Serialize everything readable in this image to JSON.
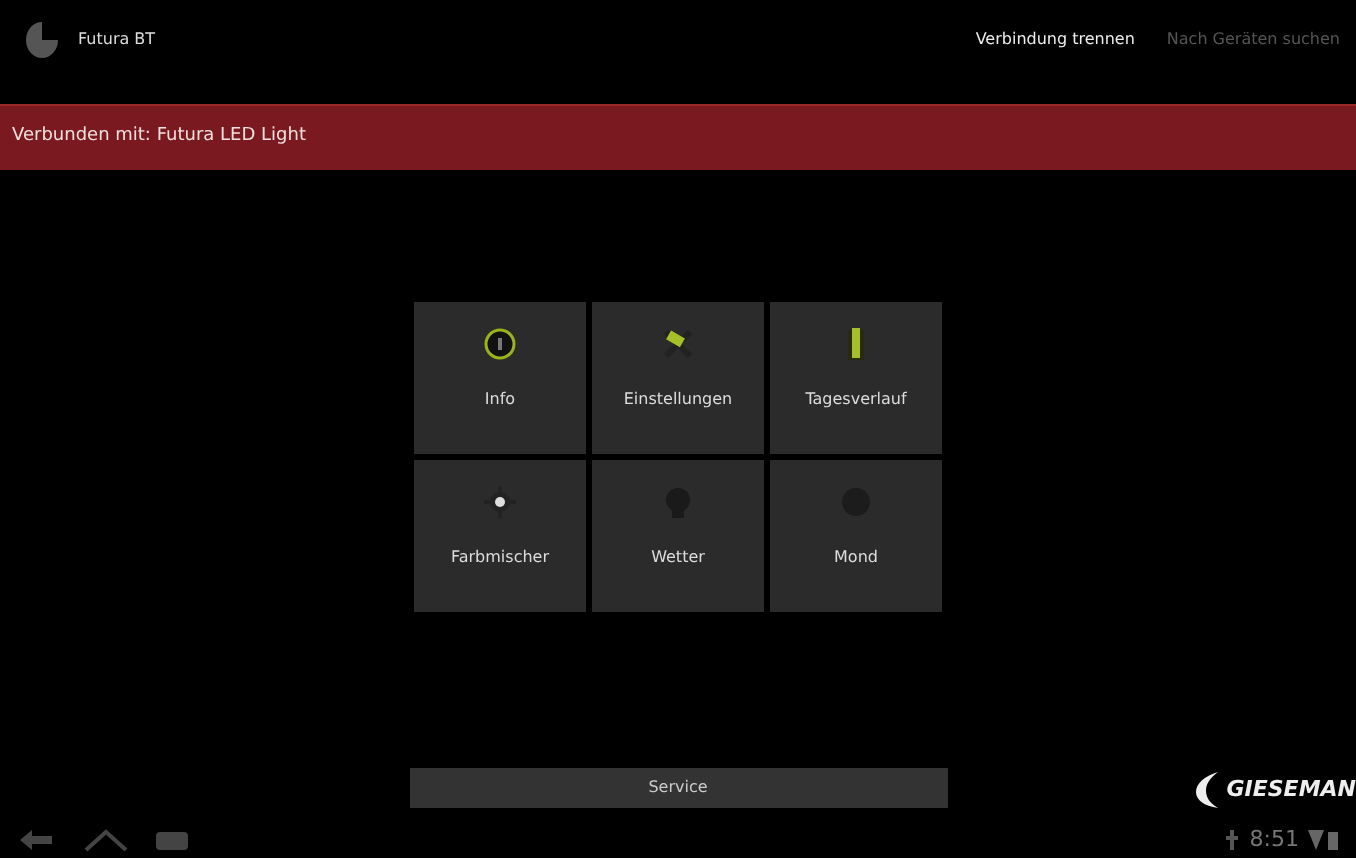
{
  "action_bar": {
    "title": "Futura BT",
    "actions": [
      {
        "label": "Verbindung trennen",
        "disabled": false
      },
      {
        "label": "Nach Geräten suchen",
        "disabled": true
      }
    ]
  },
  "banner": {
    "text": "Verbunden mit: Futura LED Light"
  },
  "tiles": [
    {
      "label": "Info",
      "kind": "info"
    },
    {
      "label": "Einstellungen",
      "kind": "settings"
    },
    {
      "label": "Tagesverlauf",
      "kind": "battery"
    },
    {
      "label": "Farbmischer",
      "kind": "sun"
    },
    {
      "label": "Wetter",
      "kind": "bulb"
    },
    {
      "label": "Mond",
      "kind": "moon"
    }
  ],
  "service_button": {
    "label": "Service"
  },
  "logo": {
    "text": "GIESEMAN"
  },
  "system_bar": {
    "time": "8:51"
  }
}
